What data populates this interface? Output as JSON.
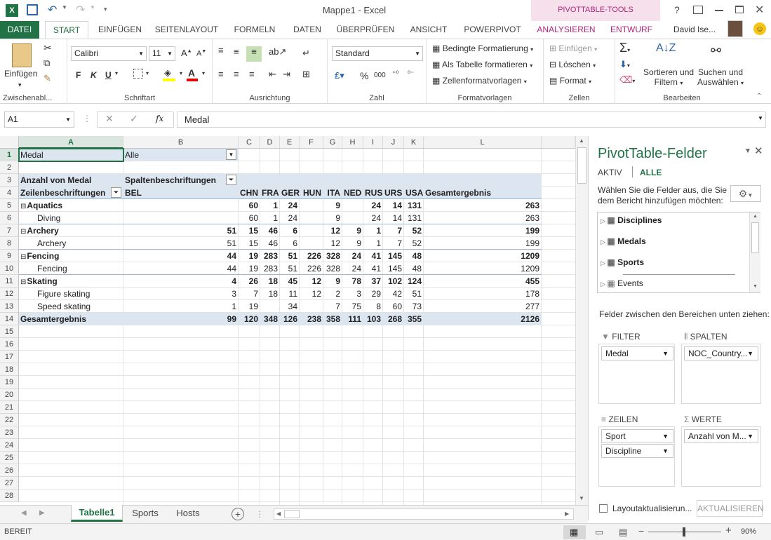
{
  "titlebar": {
    "title": "Mappe1 - Excel",
    "pivottools": "PIVOTTABLE-TOOLS",
    "help": "?"
  },
  "tabs": [
    "DATEI",
    "START",
    "EINFÜGEN",
    "SEITENLAYOUT",
    "FORMELN",
    "DATEN",
    "ÜBERPRÜFEN",
    "ANSICHT",
    "POWERPIVOT",
    "ANALYSIEREN",
    "ENTWURF"
  ],
  "user": "David Ise...",
  "ribbon": {
    "clipboard": {
      "paste": "Einfügen",
      "label": "Zwischenabl..."
    },
    "font": {
      "name": "Calibri",
      "size": "11",
      "bold": "F",
      "italic": "K",
      "underline": "U",
      "label": "Schriftart"
    },
    "align": {
      "label": "Ausrichtung"
    },
    "number": {
      "format": "Standard",
      "label": "Zahl",
      "percent": "%",
      "thousands": "000"
    },
    "styles": {
      "cond": "Bedingte Formatierung",
      "table": "Als Tabelle formatieren",
      "cell": "Zellenformatvorlagen",
      "label": "Formatvorlagen"
    },
    "cells": {
      "insert": "Einfügen",
      "delete": "Löschen",
      "format": "Format",
      "label": "Zellen"
    },
    "editing": {
      "sort1": "Sortieren und",
      "sort2": "Filtern",
      "find1": "Suchen und",
      "find2": "Auswählen",
      "label": "Bearbeiten"
    }
  },
  "formula": {
    "namebox": "A1",
    "fx": "fx",
    "value": "Medal"
  },
  "columns": [
    "A",
    "B",
    "C",
    "D",
    "E",
    "F",
    "G",
    "H",
    "I",
    "J",
    "K",
    "L"
  ],
  "rows": [
    "1",
    "2",
    "3",
    "4",
    "5",
    "6",
    "7",
    "8",
    "9",
    "10",
    "11",
    "12",
    "13",
    "14",
    "15",
    "16",
    "17",
    "18",
    "19",
    "20",
    "21",
    "22",
    "23",
    "24",
    "25",
    "26",
    "27",
    "28"
  ],
  "grid": {
    "r1": {
      "a": "Medal",
      "b": "Alle"
    },
    "r3": {
      "a": "Anzahl von Medal",
      "b": "Spaltenbeschriftungen"
    },
    "r4": {
      "a": "Zeilenbeschriftungen",
      "b": "BEL",
      "c": "CHN",
      "d": "FRA",
      "e": "GER",
      "f": "HUN",
      "g": "ITA",
      "h": "NED",
      "i": "RUS",
      "j": "URS",
      "k": "USA",
      "l": "Gesamtergebnis"
    },
    "data": [
      {
        "label": "Aquatics",
        "bold": true,
        "exp": "⊟",
        "vals": [
          "",
          "60",
          "1",
          "24",
          "",
          "9",
          "",
          "24",
          "14",
          "131",
          "263"
        ]
      },
      {
        "label": "Diving",
        "bold": false,
        "exp": "",
        "vals": [
          "",
          "60",
          "1",
          "24",
          "",
          "9",
          "",
          "24",
          "14",
          "131",
          "263"
        ]
      },
      {
        "label": "Archery",
        "bold": true,
        "exp": "⊟",
        "vals": [
          "51",
          "15",
          "46",
          "6",
          "",
          "12",
          "9",
          "1",
          "7",
          "52",
          "199"
        ]
      },
      {
        "label": "Archery",
        "bold": false,
        "exp": "",
        "vals": [
          "51",
          "15",
          "46",
          "6",
          "",
          "12",
          "9",
          "1",
          "7",
          "52",
          "199"
        ]
      },
      {
        "label": "Fencing",
        "bold": true,
        "exp": "⊟",
        "vals": [
          "44",
          "19",
          "283",
          "51",
          "226",
          "328",
          "24",
          "41",
          "145",
          "48",
          "1209"
        ]
      },
      {
        "label": "Fencing",
        "bold": false,
        "exp": "",
        "vals": [
          "44",
          "19",
          "283",
          "51",
          "226",
          "328",
          "24",
          "41",
          "145",
          "48",
          "1209"
        ]
      },
      {
        "label": "Skating",
        "bold": true,
        "exp": "⊟",
        "vals": [
          "4",
          "26",
          "18",
          "45",
          "12",
          "9",
          "78",
          "37",
          "102",
          "124",
          "455"
        ]
      },
      {
        "label": "Figure skating",
        "bold": false,
        "exp": "",
        "vals": [
          "3",
          "7",
          "18",
          "11",
          "12",
          "2",
          "3",
          "29",
          "42",
          "51",
          "178"
        ]
      },
      {
        "label": "Speed skating",
        "bold": false,
        "exp": "",
        "vals": [
          "1",
          "19",
          "",
          "34",
          "",
          "7",
          "75",
          "8",
          "60",
          "73",
          "277"
        ]
      },
      {
        "label": "Gesamtergebnis",
        "bold": true,
        "exp": "",
        "vals": [
          "99",
          "120",
          "348",
          "126",
          "238",
          "358",
          "111",
          "103",
          "268",
          "355",
          "2126"
        ]
      }
    ]
  },
  "sheets": [
    "Tabelle1",
    "Sports",
    "Hosts"
  ],
  "pane": {
    "title": "PivotTable-Felder",
    "tab_active": "AKTIV",
    "tab_all": "ALLE",
    "instruction": "Wählen Sie die Felder aus, die Sie dem Bericht hinzufügen möchten:",
    "fields": [
      "Disciplines",
      "Medals",
      "Sports",
      "Events"
    ],
    "drag": "Felder zwischen den Bereichen unten ziehen:",
    "filter": "FILTER",
    "columns": "SPALTEN",
    "rows": "ZEILEN",
    "values": "WERTE",
    "filter_items": [
      "Medal"
    ],
    "column_items": [
      "NOC_Country..."
    ],
    "row_items": [
      "Sport",
      "Discipline"
    ],
    "value_items": [
      "Anzahl von M..."
    ],
    "defer": "Layoutaktualisierun...",
    "update": "AKTUALISIEREN"
  },
  "status": {
    "ready": "BEREIT",
    "zoom": "90%"
  },
  "colors": {
    "excel_green": "#217346",
    "pivot_pink": "#b4267e",
    "pivot_bg": "#dce6f1"
  }
}
